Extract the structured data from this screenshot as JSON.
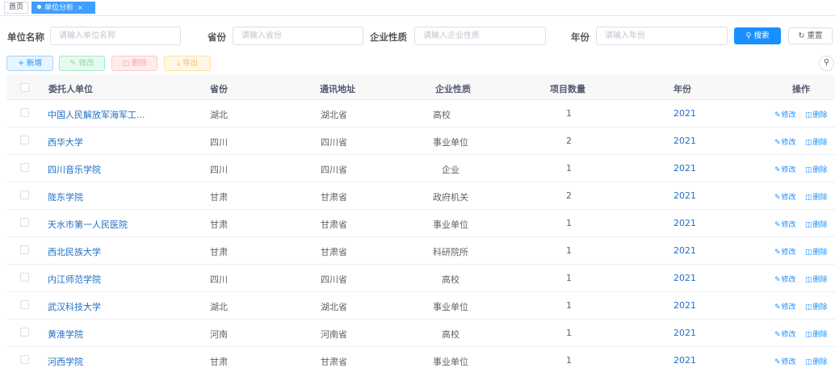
{
  "tabs": {
    "home": "首页",
    "active": "单位分析",
    "close": "×"
  },
  "search": {
    "unit_label": "单位名称",
    "unit_placeholder": "请输入单位名称",
    "province_label": "省份",
    "province_placeholder": "请输入省份",
    "nature_label": "企业性质",
    "nature_placeholder": "请输入企业性质",
    "year_label": "年份",
    "year_placeholder": "请输入年份",
    "search_button": "搜索",
    "reset_button": "重置"
  },
  "toolbar": {
    "add": "新增",
    "edit": "修改",
    "delete": "删除",
    "export": "导出"
  },
  "table": {
    "headers": {
      "client": "委托人单位",
      "province": "省份",
      "address": "通讯地址",
      "nature": "企业性质",
      "count": "项目数量",
      "year": "年份",
      "ops": "操作"
    },
    "op_edit": "修改",
    "op_delete": "删除",
    "rows": [
      {
        "client": "中国人民解放军海军工...",
        "province": "湖北",
        "address": "湖北省",
        "nature": "高校",
        "count": "1",
        "year": "2021"
      },
      {
        "client": "西华大学",
        "province": "四川",
        "address": "四川省",
        "nature": "事业单位",
        "count": "2",
        "year": "2021"
      },
      {
        "client": "四川音乐学院",
        "province": "四川",
        "address": "四川省",
        "nature": "企业",
        "count": "1",
        "year": "2021"
      },
      {
        "client": "陇东学院",
        "province": "甘肃",
        "address": "甘肃省",
        "nature": "政府机关",
        "count": "2",
        "year": "2021"
      },
      {
        "client": "天水市第一人民医院",
        "province": "甘肃",
        "address": "甘肃省",
        "nature": "事业单位",
        "count": "1",
        "year": "2021"
      },
      {
        "client": "西北民族大学",
        "province": "甘肃",
        "address": "甘肃省",
        "nature": "科研院所",
        "count": "1",
        "year": "2021"
      },
      {
        "client": "内江师范学院",
        "province": "四川",
        "address": "四川省",
        "nature": "高校",
        "count": "1",
        "year": "2021"
      },
      {
        "client": "武汉科技大学",
        "province": "湖北",
        "address": "湖北省",
        "nature": "事业单位",
        "count": "1",
        "year": "2021"
      },
      {
        "client": "黄淮学院",
        "province": "河南",
        "address": "河南省",
        "nature": "高校",
        "count": "1",
        "year": "2021"
      },
      {
        "client": "河西学院",
        "province": "甘肃",
        "address": "甘肃省",
        "nature": "事业单位",
        "count": "1",
        "year": "2021"
      }
    ]
  }
}
